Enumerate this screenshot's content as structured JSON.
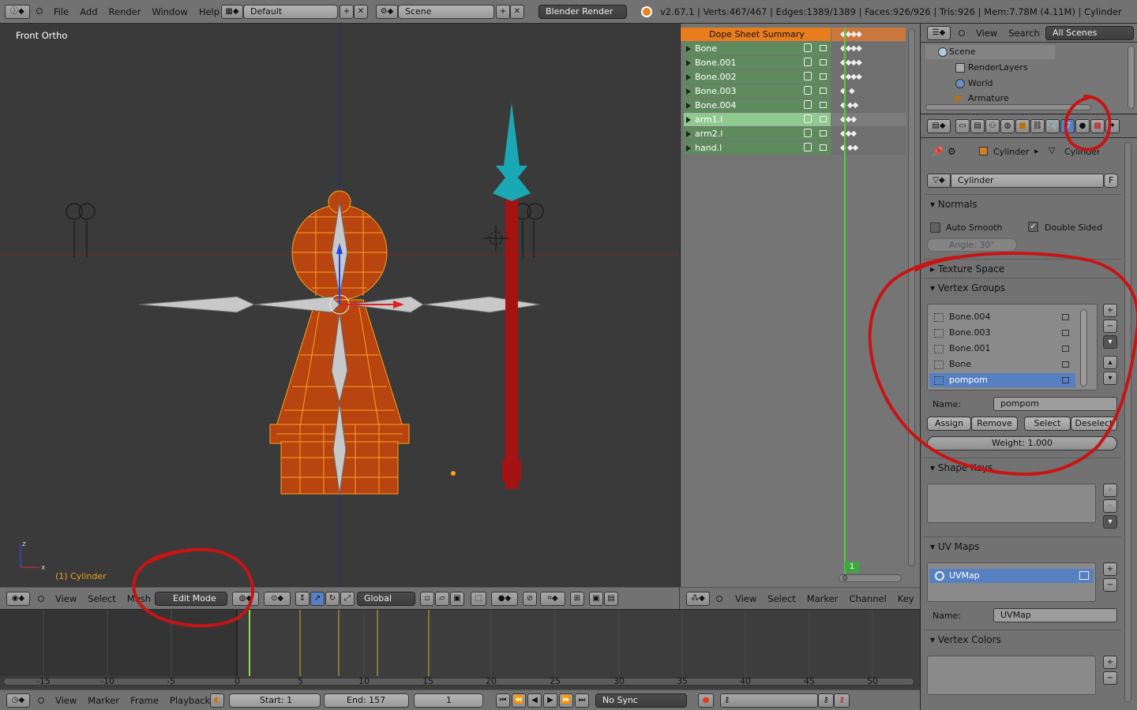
{
  "topbar": {
    "menus": [
      "File",
      "Add",
      "Render",
      "Window",
      "Help"
    ],
    "layout": "Default",
    "scene": "Scene",
    "engine": "Blender Render",
    "stats": "v2.67.1 | Verts:467/467 | Edges:1389/1389 | Faces:926/926 | Tris:926 | Mem:7.78M (4.11M) | Cylinder"
  },
  "viewport": {
    "view_name": "Front Ortho",
    "object_label": "(1) Cylinder",
    "header_menus": [
      "View",
      "Select",
      "Mesh"
    ],
    "mode": "Edit Mode",
    "orientation": "Global"
  },
  "dopesheet": {
    "summary": "Dope Sheet Summary",
    "channels": [
      "Bone",
      "Bone.001",
      "Bone.002",
      "Bone.003",
      "Bone.004",
      "arm1.l",
      "arm2.l",
      "hand.l"
    ],
    "selected": "arm1.l",
    "current_frame": "1",
    "ruler_zero": "0",
    "header_menus": [
      "View",
      "Select",
      "Marker",
      "Channel",
      "Key"
    ]
  },
  "outliner": {
    "menus": [
      "View",
      "Search"
    ],
    "scope": "All Scenes",
    "items": [
      "Scene",
      "RenderLayers",
      "World",
      "Armature"
    ]
  },
  "properties": {
    "breadcrumb_object": "Cylinder",
    "breadcrumb_data": "Cylinder",
    "datablock": "Cylinder",
    "datablock_flag": "F",
    "normals_title": "Normals",
    "auto_smooth": "Auto Smooth",
    "double_sided": "Double Sided",
    "angle": "Angle: 30°",
    "texture_space": "Texture Space",
    "vertex_groups_title": "Vertex Groups",
    "vertex_groups": [
      "Bone.004",
      "Bone.003",
      "Bone.001",
      "Bone",
      "pompom"
    ],
    "selected_group": "pompom",
    "name_label": "Name:",
    "group_name": "pompom",
    "assign": "Assign",
    "remove": "Remove",
    "select": "Select",
    "deselect": "Deselect",
    "weight": "Weight: 1.000",
    "shape_keys_title": "Shape Keys",
    "uv_maps_title": "UV Maps",
    "uv_map": "UVMap",
    "uv_name_label": "Name:",
    "uv_name": "UVMap",
    "vertex_colors_title": "Vertex Colors"
  },
  "timeline": {
    "ticks": [
      "-15",
      "-10",
      "-5",
      "0",
      "5",
      "10",
      "15",
      "20",
      "25",
      "30",
      "35",
      "40",
      "45",
      "50"
    ],
    "header_menus": [
      "View",
      "Marker",
      "Frame",
      "Playback"
    ],
    "start": "Start: 1",
    "end": "End: 157",
    "current": "1",
    "sync": "No Sync"
  },
  "colors": {
    "accent_red": "#c81414",
    "orange": "#e8821e",
    "selection_blue": "#5680c2"
  }
}
